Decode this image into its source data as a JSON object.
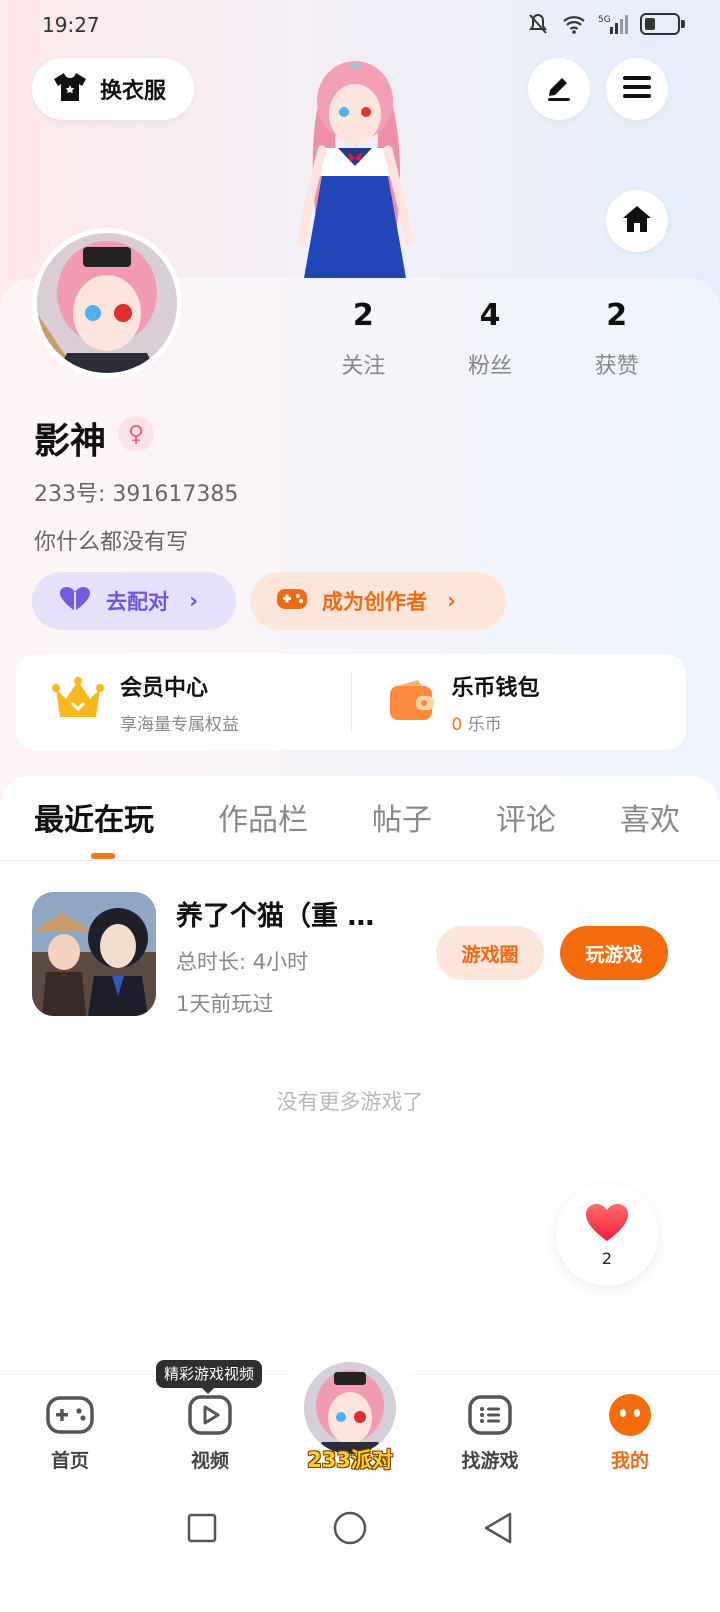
{
  "status_bar": {
    "time": "19:27",
    "network": "5G"
  },
  "top_actions": {
    "dress_label": "换衣服"
  },
  "profile": {
    "username": "影神",
    "gender_symbol": "♀",
    "uid_label": "233号: 391617385",
    "bio": "你什么都没有写",
    "stats": [
      {
        "num": "2",
        "label": "关注"
      },
      {
        "num": "4",
        "label": "粉丝"
      },
      {
        "num": "2",
        "label": "获赞"
      }
    ],
    "pair_button": "去配对",
    "creator_button": "成为创作者"
  },
  "member": {
    "vip_title": "会员中心",
    "vip_sub": "享海量专属权益",
    "wallet_title": "乐币钱包",
    "wallet_amount": "0",
    "wallet_unit": "乐币"
  },
  "tabs": [
    "最近在玩",
    "作品栏",
    "帖子",
    "评论",
    "喜欢"
  ],
  "recent_game": {
    "title": "养了个猫（重 …",
    "total_time": "总时长: 4小时",
    "last_played": "1天前玩过",
    "circle_button": "游戏圈",
    "play_button": "玩游戏"
  },
  "empty_hint": "没有更多游戏了",
  "float_like": {
    "count": "2"
  },
  "tooltip": "精彩游戏视频",
  "bottom_nav": {
    "home": "首页",
    "video": "视频",
    "center": "233派对",
    "find": "找游戏",
    "mine": "我的"
  },
  "colors": {
    "accent": "#f06a14",
    "purple": "#6f56dc"
  }
}
